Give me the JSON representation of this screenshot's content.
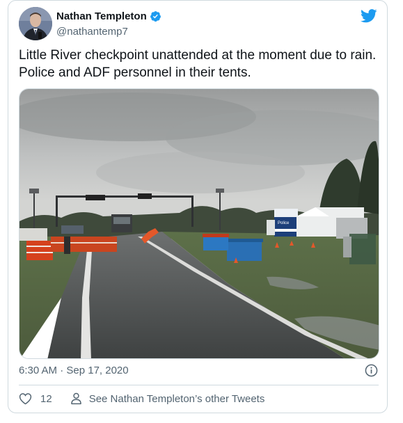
{
  "author": {
    "name": "Nathan Templeton",
    "handle": "@nathantemp7"
  },
  "tweet": {
    "text": "Little River checkpoint unattended at the moment due to rain. Police and ADF personnel in their tents.",
    "timestamp": "6:30 AM · Sep 17, 2020"
  },
  "photo": {
    "description_icon": "photo-of-road-checkpoint",
    "tent_sign": "Police"
  },
  "actions": {
    "like_count": "12",
    "see_more": "See Nathan Templeton’s other Tweets"
  },
  "colors": {
    "twitter_blue": "#1d9bf0",
    "secondary_text": "#536471",
    "border": "#cfd9de"
  },
  "icons": {
    "brand": "twitter-bird-icon",
    "verified": "verified-badge-icon",
    "info": "info-icon",
    "like": "heart-icon",
    "profile": "person-icon"
  }
}
